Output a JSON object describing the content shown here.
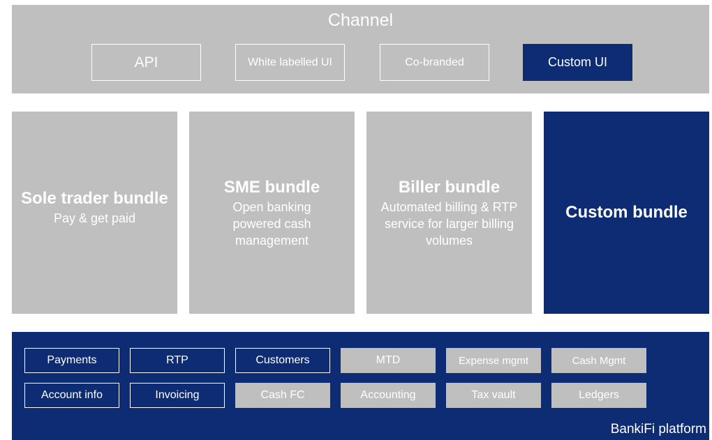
{
  "colors": {
    "gray": "#bfbfbf",
    "navy": "#0d2c73",
    "white": "#ffffff"
  },
  "channel": {
    "title": "Channel",
    "options": [
      {
        "label": "API",
        "selected": false
      },
      {
        "label": "White labelled UI",
        "selected": false
      },
      {
        "label": "Co-branded",
        "selected": false
      },
      {
        "label": "Custom UI",
        "selected": true
      }
    ]
  },
  "bundles": [
    {
      "title": "Sole trader bundle",
      "description": "Pay & get paid",
      "selected": false
    },
    {
      "title": "SME bundle",
      "description": "Open banking powered cash management",
      "selected": false
    },
    {
      "title": "Biller bundle",
      "description": "Automated billing & RTP service for larger billing volumes",
      "selected": false
    },
    {
      "title": "Custom bundle",
      "description": "",
      "selected": true
    }
  ],
  "platform": {
    "label": "BankiFi platform",
    "features": [
      {
        "label": "Payments",
        "enabled": true
      },
      {
        "label": "RTP",
        "enabled": true
      },
      {
        "label": "Customers",
        "enabled": true
      },
      {
        "label": "MTD",
        "enabled": false
      },
      {
        "label": "Expense mgmt",
        "enabled": false
      },
      {
        "label": "Cash Mgmt",
        "enabled": false
      },
      {
        "label": "Account info",
        "enabled": true
      },
      {
        "label": "Invoicing",
        "enabled": true
      },
      {
        "label": "Cash FC",
        "enabled": false
      },
      {
        "label": "Accounting",
        "enabled": false
      },
      {
        "label": "Tax vault",
        "enabled": false
      },
      {
        "label": "Ledgers",
        "enabled": false
      }
    ]
  }
}
